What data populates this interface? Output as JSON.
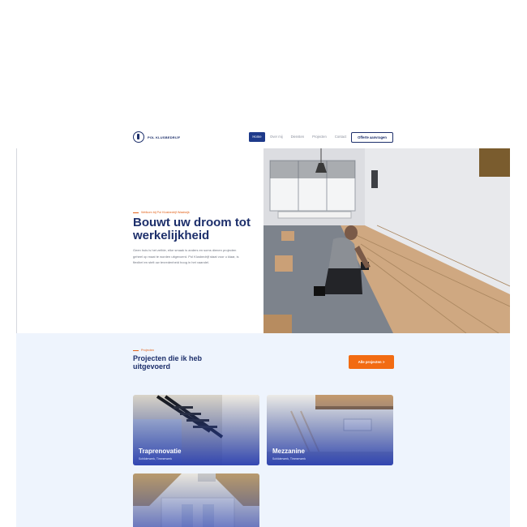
{
  "header": {
    "logo_text": "POL KLUSBEDRIJF",
    "nav": [
      "Home",
      "Over mij",
      "Diensten",
      "Projecten",
      "Contact"
    ],
    "cta": "Offerte aanvragen"
  },
  "hero": {
    "eyebrow": "Welkom bij Pol Klusbedrijf Waalwijk",
    "title": "Bouwt uw droom tot werkelijkheid",
    "text": "Geen huis is het zelfde, elke smaak is anders en soms dienen projecten geheel op maat te worden uitgevoerd. Pol Klusbedrijf staat voor u klaar, is flexibel en stelt uw tevredenheid hoog in het vaandel."
  },
  "projects": {
    "eyebrow": "Projecten",
    "title": "Projecten die ik heb uitgevoerd",
    "all_button": "Alle projecten >",
    "items": [
      {
        "title": "Traprenovatie",
        "subtitle": "Schilderwerk, Timmerwerk"
      },
      {
        "title": "Mezzanine",
        "subtitle": "Schilderwerk, Timmerwerk"
      }
    ]
  },
  "colors": {
    "brand_navy": "#1d2f6b",
    "accent_orange": "#f26b12",
    "section_bg": "#eef4fd"
  }
}
